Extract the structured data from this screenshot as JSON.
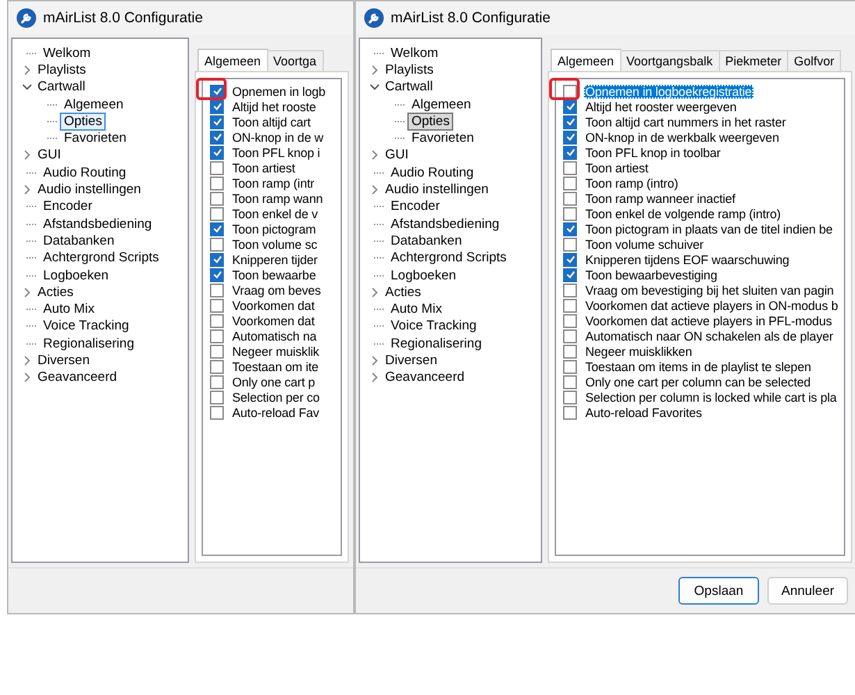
{
  "windows": [
    {
      "title": "mAirList 8.0 Configuratie",
      "tree_focused": true,
      "tree": [
        {
          "label": "Welkom",
          "kind": "leaf",
          "selected": false
        },
        {
          "label": "Playlists",
          "kind": "group",
          "expanded": false,
          "selected": false
        },
        {
          "label": "Cartwall",
          "kind": "group",
          "expanded": true,
          "selected": false,
          "children": [
            {
              "label": "Algemeen",
              "kind": "leaf",
              "selected": false
            },
            {
              "label": "Opties",
              "kind": "leaf",
              "selected": true
            },
            {
              "label": "Favorieten",
              "kind": "leaf",
              "selected": false
            }
          ]
        },
        {
          "label": "GUI",
          "kind": "group",
          "expanded": false,
          "selected": false
        },
        {
          "label": "Audio Routing",
          "kind": "leaf",
          "selected": false
        },
        {
          "label": "Audio instellingen",
          "kind": "group",
          "expanded": false,
          "selected": false
        },
        {
          "label": "Encoder",
          "kind": "leaf",
          "selected": false
        },
        {
          "label": "Afstandsbediening",
          "kind": "leaf",
          "selected": false
        },
        {
          "label": "Databanken",
          "kind": "leaf",
          "selected": false
        },
        {
          "label": "Achtergrond Scripts",
          "kind": "leaf",
          "selected": false
        },
        {
          "label": "Logboeken",
          "kind": "leaf",
          "selected": false
        },
        {
          "label": "Acties",
          "kind": "group",
          "expanded": false,
          "selected": false
        },
        {
          "label": "Auto Mix",
          "kind": "leaf",
          "selected": false
        },
        {
          "label": "Voice Tracking",
          "kind": "leaf",
          "selected": false
        },
        {
          "label": "Regionalisering",
          "kind": "leaf",
          "selected": false
        },
        {
          "label": "Diversen",
          "kind": "group",
          "expanded": false,
          "selected": false
        },
        {
          "label": "Geavanceerd",
          "kind": "group",
          "expanded": false,
          "selected": false
        }
      ],
      "tabs": [
        {
          "label": "Algemeen",
          "selected": true
        },
        {
          "label": "Voortga",
          "selected": false
        }
      ],
      "options": [
        {
          "label": "Opnemen in logb",
          "checked": true,
          "selected": false,
          "marked": true
        },
        {
          "label": "Altijd het rooste",
          "checked": true,
          "selected": false,
          "marked": false
        },
        {
          "label": "Toon altijd cart",
          "checked": true,
          "selected": false,
          "marked": false
        },
        {
          "label": "ON-knop in de w",
          "checked": true,
          "selected": false,
          "marked": false
        },
        {
          "label": "Toon PFL knop i",
          "checked": true,
          "selected": false,
          "marked": false
        },
        {
          "label": "Toon artiest",
          "checked": false,
          "selected": false,
          "marked": false
        },
        {
          "label": "Toon ramp (intr",
          "checked": false,
          "selected": false,
          "marked": false
        },
        {
          "label": "Toon ramp wann",
          "checked": false,
          "selected": false,
          "marked": false
        },
        {
          "label": "Toon enkel de v",
          "checked": false,
          "selected": false,
          "marked": false
        },
        {
          "label": "Toon pictogram",
          "checked": true,
          "selected": false,
          "marked": false
        },
        {
          "label": "Toon volume sc",
          "checked": false,
          "selected": false,
          "marked": false
        },
        {
          "label": "Knipperen tijder",
          "checked": true,
          "selected": false,
          "marked": false
        },
        {
          "label": "Toon bewaarbe",
          "checked": true,
          "selected": false,
          "marked": false
        },
        {
          "label": "Vraag om beves",
          "checked": false,
          "selected": false,
          "marked": false
        },
        {
          "label": "Voorkomen dat",
          "checked": false,
          "selected": false,
          "marked": false
        },
        {
          "label": "Voorkomen dat",
          "checked": false,
          "selected": false,
          "marked": false
        },
        {
          "label": "Automatisch na",
          "checked": false,
          "selected": false,
          "marked": false
        },
        {
          "label": "Negeer muisklik",
          "checked": false,
          "selected": false,
          "marked": false
        },
        {
          "label": "Toestaan om ite",
          "checked": false,
          "selected": false,
          "marked": false
        },
        {
          "label": "Only one cart p",
          "checked": false,
          "selected": false,
          "marked": false
        },
        {
          "label": "Selection per co",
          "checked": false,
          "selected": false,
          "marked": false
        },
        {
          "label": "Auto-reload Fav",
          "checked": false,
          "selected": false,
          "marked": false
        }
      ]
    },
    {
      "title": "mAirList 8.0 Configuratie",
      "tree_focused": false,
      "tree": [
        {
          "label": "Welkom",
          "kind": "leaf",
          "selected": false
        },
        {
          "label": "Playlists",
          "kind": "group",
          "expanded": false,
          "selected": false
        },
        {
          "label": "Cartwall",
          "kind": "group",
          "expanded": true,
          "selected": false,
          "children": [
            {
              "label": "Algemeen",
              "kind": "leaf",
              "selected": false
            },
            {
              "label": "Opties",
              "kind": "leaf",
              "selected": true
            },
            {
              "label": "Favorieten",
              "kind": "leaf",
              "selected": false
            }
          ]
        },
        {
          "label": "GUI",
          "kind": "group",
          "expanded": false,
          "selected": false
        },
        {
          "label": "Audio Routing",
          "kind": "leaf",
          "selected": false
        },
        {
          "label": "Audio instellingen",
          "kind": "group",
          "expanded": false,
          "selected": false
        },
        {
          "label": "Encoder",
          "kind": "leaf",
          "selected": false
        },
        {
          "label": "Afstandsbediening",
          "kind": "leaf",
          "selected": false
        },
        {
          "label": "Databanken",
          "kind": "leaf",
          "selected": false
        },
        {
          "label": "Achtergrond Scripts",
          "kind": "leaf",
          "selected": false
        },
        {
          "label": "Logboeken",
          "kind": "leaf",
          "selected": false
        },
        {
          "label": "Acties",
          "kind": "group",
          "expanded": false,
          "selected": false
        },
        {
          "label": "Auto Mix",
          "kind": "leaf",
          "selected": false
        },
        {
          "label": "Voice Tracking",
          "kind": "leaf",
          "selected": false
        },
        {
          "label": "Regionalisering",
          "kind": "leaf",
          "selected": false
        },
        {
          "label": "Diversen",
          "kind": "group",
          "expanded": false,
          "selected": false
        },
        {
          "label": "Geavanceerd",
          "kind": "group",
          "expanded": false,
          "selected": false
        }
      ],
      "tabs": [
        {
          "label": "Algemeen",
          "selected": true
        },
        {
          "label": "Voortgangsbalk",
          "selected": false
        },
        {
          "label": "Piekmeter",
          "selected": false
        },
        {
          "label": "Golfvor",
          "selected": false
        }
      ],
      "options": [
        {
          "label": "Opnemen in logboekregistratie",
          "checked": false,
          "selected": true,
          "marked": true
        },
        {
          "label": "Altijd het rooster weergeven",
          "checked": true,
          "selected": false,
          "marked": false
        },
        {
          "label": "Toon altijd cart nummers in het raster",
          "checked": true,
          "selected": false,
          "marked": false
        },
        {
          "label": "ON-knop in de werkbalk weergeven",
          "checked": true,
          "selected": false,
          "marked": false
        },
        {
          "label": "Toon PFL knop in toolbar",
          "checked": true,
          "selected": false,
          "marked": false
        },
        {
          "label": "Toon artiest",
          "checked": false,
          "selected": false,
          "marked": false
        },
        {
          "label": "Toon ramp (intro)",
          "checked": false,
          "selected": false,
          "marked": false
        },
        {
          "label": "Toon ramp wanneer inactief",
          "checked": false,
          "selected": false,
          "marked": false
        },
        {
          "label": "Toon enkel de volgende ramp (intro)",
          "checked": false,
          "selected": false,
          "marked": false
        },
        {
          "label": "Toon pictogram in plaats van de titel indien be",
          "checked": true,
          "selected": false,
          "marked": false
        },
        {
          "label": "Toon volume schuiver",
          "checked": false,
          "selected": false,
          "marked": false
        },
        {
          "label": "Knipperen tijdens EOF waarschuwing",
          "checked": true,
          "selected": false,
          "marked": false
        },
        {
          "label": "Toon bewaarbevestiging",
          "checked": true,
          "selected": false,
          "marked": false
        },
        {
          "label": "Vraag om bevestiging bij het sluiten van pagin",
          "checked": false,
          "selected": false,
          "marked": false
        },
        {
          "label": "Voorkomen dat actieve players in ON-modus b",
          "checked": false,
          "selected": false,
          "marked": false
        },
        {
          "label": "Voorkomen dat actieve players in PFL-modus",
          "checked": false,
          "selected": false,
          "marked": false
        },
        {
          "label": "Automatisch naar ON schakelen als de player",
          "checked": false,
          "selected": false,
          "marked": false
        },
        {
          "label": "Negeer muisklikken",
          "checked": false,
          "selected": false,
          "marked": false
        },
        {
          "label": "Toestaan om items in de playlist te slepen",
          "checked": false,
          "selected": false,
          "marked": false
        },
        {
          "label": "Only one cart per column can be selected",
          "checked": false,
          "selected": false,
          "marked": false
        },
        {
          "label": "Selection per column is locked while cart is pla",
          "checked": false,
          "selected": false,
          "marked": false
        },
        {
          "label": "Auto-reload Favorites",
          "checked": false,
          "selected": false,
          "marked": false
        }
      ],
      "buttons": [
        {
          "label": "Opslaan",
          "default": true
        },
        {
          "label": "Annuleer",
          "default": false
        }
      ]
    }
  ]
}
